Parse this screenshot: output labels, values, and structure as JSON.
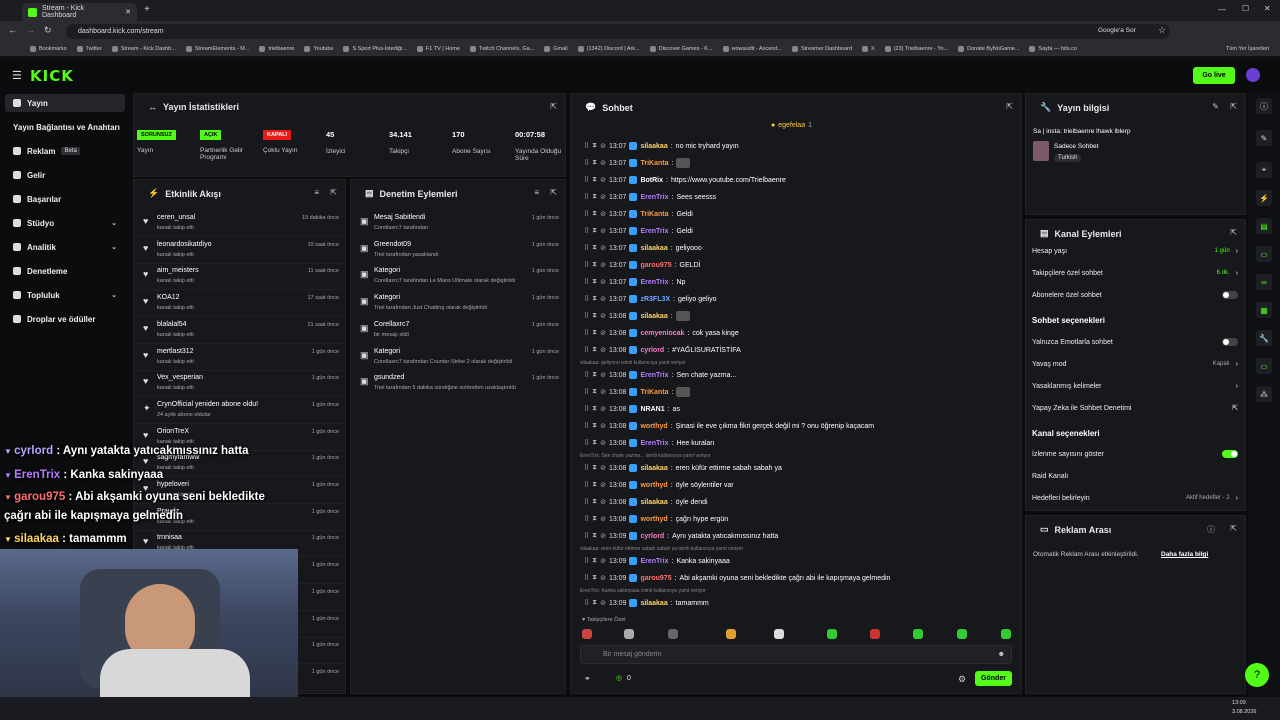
{
  "browser": {
    "tab_title": "Stream - Kick Dashboard",
    "url": "dashboard.kick.com/stream",
    "google_btn": "Google'a Sor",
    "bookmarks": [
      "Bookmarks",
      "Twitter",
      "Stream - Kick Dashb...",
      "StreamElements - M...",
      "trielbaenre",
      "Youtube",
      "S Sport Plus-İstediği...",
      "F1 TV | Home",
      "Twitch Channels, Ga...",
      "Gmail",
      "(1342) Discord | Ark...",
      "Discover Games - K...",
      "wowaudit - Ascend...",
      "Streamer Dashboard",
      "X",
      "(23) Trielbaenre - Yo...",
      "Donate ByNoGame...",
      "Sayfa — hits.co"
    ],
    "all_bookmarks": "Tüm Yer İşaretleri"
  },
  "header": {
    "logo": "KICK",
    "go_live": "Go live"
  },
  "sidebar": {
    "items": [
      {
        "label": "Yayın"
      },
      {
        "label": "Yayın Bağlantısı ve Anahtarı"
      },
      {
        "label": "Reklam",
        "badge": "Beta"
      },
      {
        "label": "Gelir"
      },
      {
        "label": "Başarılar"
      },
      {
        "label": "Stüdyo"
      },
      {
        "label": "Analitik"
      },
      {
        "label": "Denetleme"
      },
      {
        "label": "Topluluk"
      },
      {
        "label": "Droplar ve ödüller"
      }
    ]
  },
  "stats": {
    "title": "Yayın İstatistikleri",
    "items": [
      {
        "pill": "SORUNSUZ",
        "label": "Yayın",
        "color": "#53fc18"
      },
      {
        "pill": "AÇIK",
        "label": "Partnerlik Gelir Programı",
        "color": "#53fc18"
      },
      {
        "pill": "KAPALI",
        "label": "Çoklu Yayın",
        "color": "#e91916"
      },
      {
        "value": "45",
        "label": "İzleyici"
      },
      {
        "value": "34.141",
        "label": "Takipçi"
      },
      {
        "value": "170",
        "label": "Abone Sayısı"
      },
      {
        "value": "00:07:58",
        "label": "Yayında Olduğu Süre"
      }
    ]
  },
  "activity": {
    "title": "Etkinlik Akışı",
    "rows": [
      {
        "name": "ceren_unsal",
        "sub": "kanalı takip etti",
        "time": "19 dakika önce"
      },
      {
        "name": "leonardosikatdiyo",
        "sub": "kanalı takip etti",
        "time": "10 saat önce"
      },
      {
        "name": "aim_meisters",
        "sub": "kanalı takip etti",
        "time": "11 saat önce"
      },
      {
        "name": "KOA12",
        "sub": "kanalı takip etti",
        "time": "17 saat önce"
      },
      {
        "name": "blalalal54",
        "sub": "kanalı takip etti",
        "time": "21 saat önce"
      },
      {
        "name": "mertlast312",
        "sub": "kanalı takip etti",
        "time": "1 gün önce"
      },
      {
        "name": "Vex_vesperian",
        "sub": "kanalı takip etti",
        "time": "1 gün önce"
      },
      {
        "name": "CrynOfficial yeniden abone oldu!",
        "sub": "24 aylık abone oldular",
        "time": "1 gün önce"
      },
      {
        "name": "OrionTreX",
        "sub": "kanalı takip etti",
        "time": "1 gün önce"
      },
      {
        "name": "sagmyfamww",
        "sub": "kanalı takip etti",
        "time": "1 gün önce"
      },
      {
        "name": "hypeloveri",
        "sub": "kanalı takip etti",
        "time": "1 gün önce"
      },
      {
        "name": "Praudz",
        "sub": "kanalı takip etti",
        "time": "1 gün önce"
      },
      {
        "name": "trnnisaa",
        "sub": "kanalı takip etti",
        "time": "1 gün önce"
      }
    ],
    "extra_times": [
      "1 gün önce",
      "1 gün önce",
      "1 gün önce",
      "1 gün önce",
      "1 gün önce"
    ]
  },
  "mod": {
    "title": "Denetim Eylemleri",
    "rows": [
      {
        "name": "Mesaj Sabitlendi",
        "sub": "Corellaxrc7 tarafından",
        "time": "1 gün önce"
      },
      {
        "name": "Greendot09",
        "sub": "Triel tarafından yasaklandı",
        "time": "1 gün önce"
      },
      {
        "name": "Kategori",
        "sub": "Corellaxrc7 tarafından Le Mans Ultimate olarak değiştirildi",
        "time": "1 gün önce"
      },
      {
        "name": "Kategori",
        "sub": "Triel tarafından Just Chatting olarak değiştirildi",
        "time": "1 gün önce"
      },
      {
        "name": "Corellaxrc7",
        "sub": "bir mesajı sildi",
        "time": "1 gün önce"
      },
      {
        "name": "Kategori",
        "sub": "Corellaxrc7 tarafından Counter-Strike 2 olarak değiştirildi",
        "time": "1 gün önce"
      },
      {
        "name": "gsundzed",
        "sub": "Triel tarafından 5 dakika süreliğine sohbetten uzaklaştırıldı",
        "time": "1 gün önce"
      }
    ]
  },
  "chat": {
    "title": "Sohbet",
    "pinned_user": "egefelaa",
    "pinned_count": "1",
    "lines": [
      {
        "t": "13:07",
        "u": "silaakaa",
        "c": "#ffd766",
        "m": "no mic tryhard yayın"
      },
      {
        "t": "13:07",
        "u": "TriKanta",
        "c": "#ff9a3d",
        "m": ""
      },
      {
        "t": "13:07",
        "u": "BotRix",
        "c": "#ffffff",
        "m": "https://www.youtube.com/Trielbaenre"
      },
      {
        "t": "13:07",
        "u": "ErenTrix",
        "c": "#b57cff",
        "m": "Sees seesss"
      },
      {
        "t": "13:07",
        "u": "TriKanta",
        "c": "#ff9a3d",
        "m": "Geldi"
      },
      {
        "t": "13:07",
        "u": "ErenTrix",
        "c": "#b57cff",
        "m": "Geldi"
      },
      {
        "t": "13:07",
        "u": "silaakaa",
        "c": "#ffd766",
        "m": "geliyooo"
      },
      {
        "t": "13:07",
        "u": "garou975",
        "c": "#ff6f6f",
        "m": "GELDİ"
      },
      {
        "t": "13:07",
        "u": "ErenTrix",
        "c": "#b57cff",
        "m": "Np"
      },
      {
        "t": "13:07",
        "u": "zR3FL3X",
        "c": "#6fa8ff",
        "m": "geliyo geliyo"
      },
      {
        "t": "13:08",
        "u": "silaakaa",
        "c": "#ffd766",
        "m": ""
      },
      {
        "t": "13:08",
        "u": "cemyeniocak",
        "c": "#ff7ac6",
        "m": "cok yasa kinge"
      },
      {
        "t": "13:08",
        "u": "cyrlord",
        "c": "#ff7ac6",
        "m": "#YAĞLISURATİSTİFA"
      },
      {
        "t": "13:08",
        "u": "ErenTrix",
        "c": "#b57cff",
        "m": "Sen chate yazma..."
      },
      {
        "t": "13:08",
        "u": "TriKanta",
        "c": "#ff9a3d",
        "m": ""
      },
      {
        "t": "13:08",
        "u": "NRAN1",
        "c": "#ffffff",
        "m": "as"
      },
      {
        "t": "13:08",
        "u": "worthyd",
        "c": "#ff9a3d",
        "m": "Şinasi ile eve çıkma fikri gerçek değil mi ? onu öğrenip kaçacam"
      },
      {
        "t": "13:08",
        "u": "ErenTrix",
        "c": "#b57cff",
        "m": "Hee kuraları"
      },
      {
        "t": "13:08",
        "u": "silaakaa",
        "c": "#ffd766",
        "m": "eren küfür ettirme sabah sabah ya"
      },
      {
        "t": "13:08",
        "u": "worthyd",
        "c": "#ff9a3d",
        "m": "öyle söylentiler var"
      },
      {
        "t": "13:08",
        "u": "silaakaa",
        "c": "#ffd766",
        "m": "öyle dendi"
      },
      {
        "t": "13:08",
        "u": "worthyd",
        "c": "#ff9a3d",
        "m": "çağrı hype ergün"
      },
      {
        "t": "13:09",
        "u": "cyrlord",
        "c": "#ff7ac6",
        "m": "Aynı yatakta yatıcakmıssınız hatta"
      },
      {
        "t": "13:09",
        "u": "ErenTrix",
        "c": "#b57cff",
        "m": "Kanka sakinyaaa"
      },
      {
        "t": "13:09",
        "u": "garou975",
        "c": "#ff6f6f",
        "m": "Abi akşamki oyuna seni bekledikte çağrı abi ile kapışmaya gelmedin"
      },
      {
        "t": "13:09",
        "u": "silaakaa",
        "c": "#ffd766",
        "m": "tamammm"
      }
    ],
    "replies": [
      "silaakaa: geliyooo isimli kullanıcıya yanıt veriyor",
      "ErenTrix: Sen chate yazma... isimli kullanıcıya yanıt veriyor",
      "silaakaa: eren küfür ettirme sabah sabah ya isimli kullanıcıya yanıt veriyor",
      "ErenTrix: Kanka sakinyaaa isimli kullanıcıya yanıt veriyor"
    ],
    "followers_only": "Takipçilere Özel",
    "placeholder": "Bir mesaj gönderin",
    "count": "0",
    "send": "Gönder"
  },
  "info": {
    "title": "Yayın bilgisi",
    "stream_title": "Sa | insta: trielbaenre lhawk lblerp",
    "category": "Sadece Sohbet",
    "language": "Turkish"
  },
  "actions": {
    "title": "Kanal Eylemleri",
    "account_age": "Hesap yaşı",
    "account_age_val": "1 gün",
    "follower_chat": "Takipçilere özel sohbet",
    "follower_chat_val": "6 dk.",
    "sub_chat": "Abonelere özel sohbet",
    "chat_settings": "Sohbet seçenekleri",
    "emote_only": "Yalnızca Emotlarla sohbet",
    "slow_mode": "Yavaş mod",
    "slow_mode_val": "Kapalı",
    "banned_words": "Yasaklanmış kelimeler",
    "ai_mod": "Yapay Zeka ile Sohbet Denetimi",
    "channel_settings": "Kanal seçenekleri",
    "show_viewers": "İzlenme sayısını göster",
    "raid": "Raid Kanalı",
    "goals": "Hedefleri belirleyin",
    "goals_val": "Aktif hedefler - 2"
  },
  "ads": {
    "title": "Reklam Arası",
    "text": "Otomatik Reklam Arası etkinleştirildi.",
    "link": "Daha fazla bilgi"
  },
  "overlay": [
    {
      "u": "cyrlord",
      "m": " : Aynı yatakta yatıcakmıssınız hatta",
      "c": "#b9a5ff"
    },
    {
      "u": "ErenTrix",
      "m": " : Kanka sakinyaaa",
      "c": "#b57cff"
    },
    {
      "u": "garou975",
      "m": " : Abi akşamki oyuna seni bekledikte",
      "c": "#ff6f6f"
    },
    {
      "u": "",
      "m": "çağrı abi ile kapışmaya gelmedin",
      "c": "#ffffff"
    },
    {
      "u": "silaakaa",
      "m": " : tamammm",
      "c": "#ffd766"
    }
  ],
  "taskbar": {
    "time": "13:09",
    "date": "3.08.2026"
  }
}
